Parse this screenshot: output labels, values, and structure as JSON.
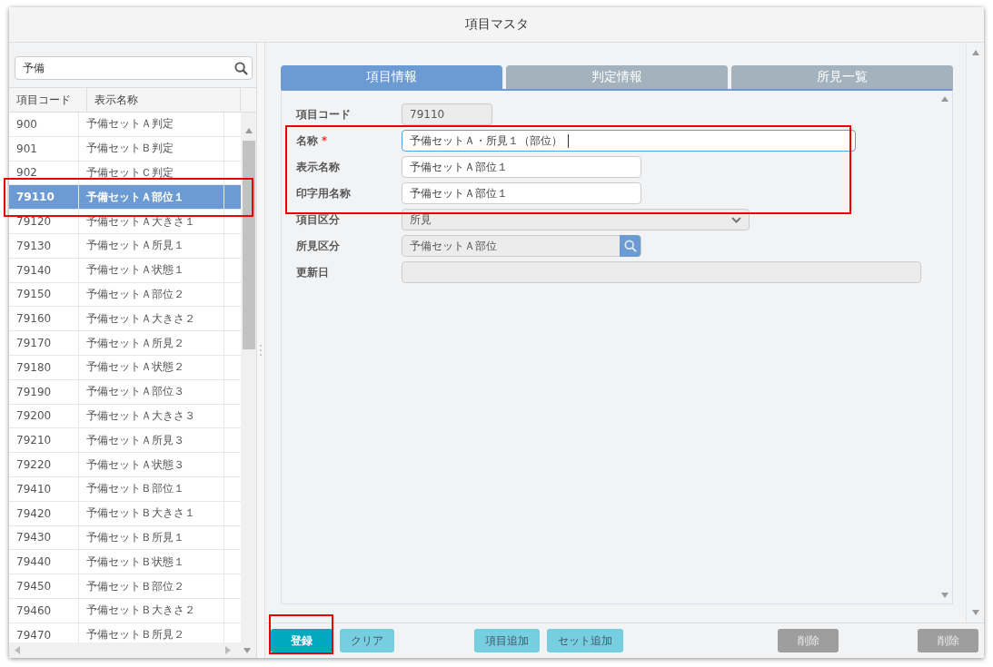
{
  "window": {
    "title": "項目マスタ"
  },
  "search": {
    "value": "予備"
  },
  "list": {
    "columns": [
      "項目コード",
      "表示名称"
    ],
    "rows": [
      {
        "code": "900",
        "name": "予備セットＡ判定",
        "selected": false
      },
      {
        "code": "901",
        "name": "予備セットＢ判定",
        "selected": false
      },
      {
        "code": "902",
        "name": "予備セットＣ判定",
        "selected": false
      },
      {
        "code": "79110",
        "name": "予備セットＡ部位１",
        "selected": true
      },
      {
        "code": "79120",
        "name": "予備セットＡ大きさ１",
        "selected": false
      },
      {
        "code": "79130",
        "name": "予備セットＡ所見１",
        "selected": false
      },
      {
        "code": "79140",
        "name": "予備セットＡ状態１",
        "selected": false
      },
      {
        "code": "79150",
        "name": "予備セットＡ部位２",
        "selected": false
      },
      {
        "code": "79160",
        "name": "予備セットＡ大きさ２",
        "selected": false
      },
      {
        "code": "79170",
        "name": "予備セットＡ所見２",
        "selected": false
      },
      {
        "code": "79180",
        "name": "予備セットＡ状態２",
        "selected": false
      },
      {
        "code": "79190",
        "name": "予備セットＡ部位３",
        "selected": false
      },
      {
        "code": "79200",
        "name": "予備セットＡ大きさ３",
        "selected": false
      },
      {
        "code": "79210",
        "name": "予備セットＡ所見３",
        "selected": false
      },
      {
        "code": "79220",
        "name": "予備セットＡ状態３",
        "selected": false
      },
      {
        "code": "79410",
        "name": "予備セットＢ部位１",
        "selected": false
      },
      {
        "code": "79420",
        "name": "予備セットＢ大きさ１",
        "selected": false
      },
      {
        "code": "79430",
        "name": "予備セットＢ所見１",
        "selected": false
      },
      {
        "code": "79440",
        "name": "予備セットＢ状態１",
        "selected": false
      },
      {
        "code": "79450",
        "name": "予備セットＢ部位２",
        "selected": false
      },
      {
        "code": "79460",
        "name": "予備セットＢ大きさ２",
        "selected": false
      },
      {
        "code": "79470",
        "name": "予備セットＢ所見２",
        "selected": false
      }
    ]
  },
  "tabs": [
    {
      "label": "項目情報",
      "selected": true
    },
    {
      "label": "判定情報",
      "selected": false
    },
    {
      "label": "所見一覧",
      "selected": false
    }
  ],
  "form": [
    {
      "label": "項目コード",
      "value": "79110",
      "kind": "text",
      "disabled": true,
      "focused": false
    },
    {
      "label": "名称",
      "required_mark": "*",
      "value": "予備セットＡ・所見１（部位）",
      "kind": "text",
      "disabled": false,
      "focused": true
    },
    {
      "label": "表示名称",
      "value": "予備セットＡ部位１",
      "kind": "text",
      "disabled": false,
      "focused": false
    },
    {
      "label": "印字用名称",
      "value": "予備セットＡ部位１",
      "kind": "text",
      "disabled": false,
      "focused": false
    },
    {
      "label": "項目区分",
      "value": "所見",
      "kind": "select",
      "disabled": true,
      "focused": false
    },
    {
      "label": "所見区分",
      "value": "予備セットＡ部位",
      "kind": "lookup",
      "disabled": true,
      "focused": false
    },
    {
      "label": "更新日",
      "kind": "text",
      "disabled": true,
      "focused": false
    }
  ],
  "buttons": [
    {
      "label": "登録",
      "kind": "primary"
    },
    {
      "label": "クリア",
      "kind": "secondary"
    },
    {
      "label": "項目追加",
      "kind": "secondary"
    },
    {
      "label": "セット追加",
      "kind": "secondary"
    },
    {
      "label": "削除",
      "kind": "disabled"
    },
    {
      "label": "削除",
      "kind": "disabled"
    }
  ]
}
